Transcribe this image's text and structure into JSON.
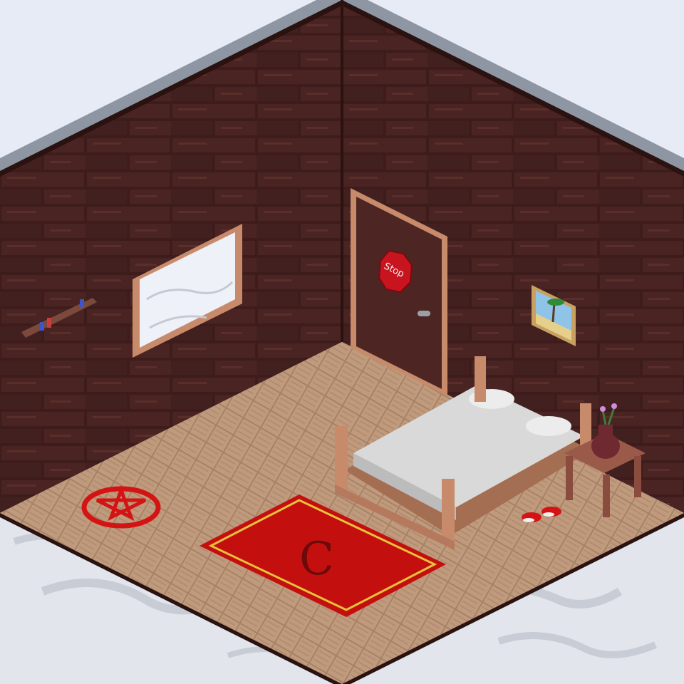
{
  "scene": {
    "sign_text": "Stop",
    "rug_letter": "C"
  },
  "icons": {
    "sign": "stop-sign-icon",
    "pentagram": "pentagram-icon"
  },
  "colors": {
    "background": "#e6ebf5",
    "wall_dark": "#3d1c1b",
    "wall_mid": "#4a2422",
    "floor": "#c09a7c",
    "rug": "#c40f0f",
    "rug_trim": "#e8c23a",
    "pentagram": "#d41414",
    "bed_frame": "#c78b6c",
    "sheets": "#d9d9d9",
    "door": "#4d2624",
    "sign": "#c8141e"
  }
}
